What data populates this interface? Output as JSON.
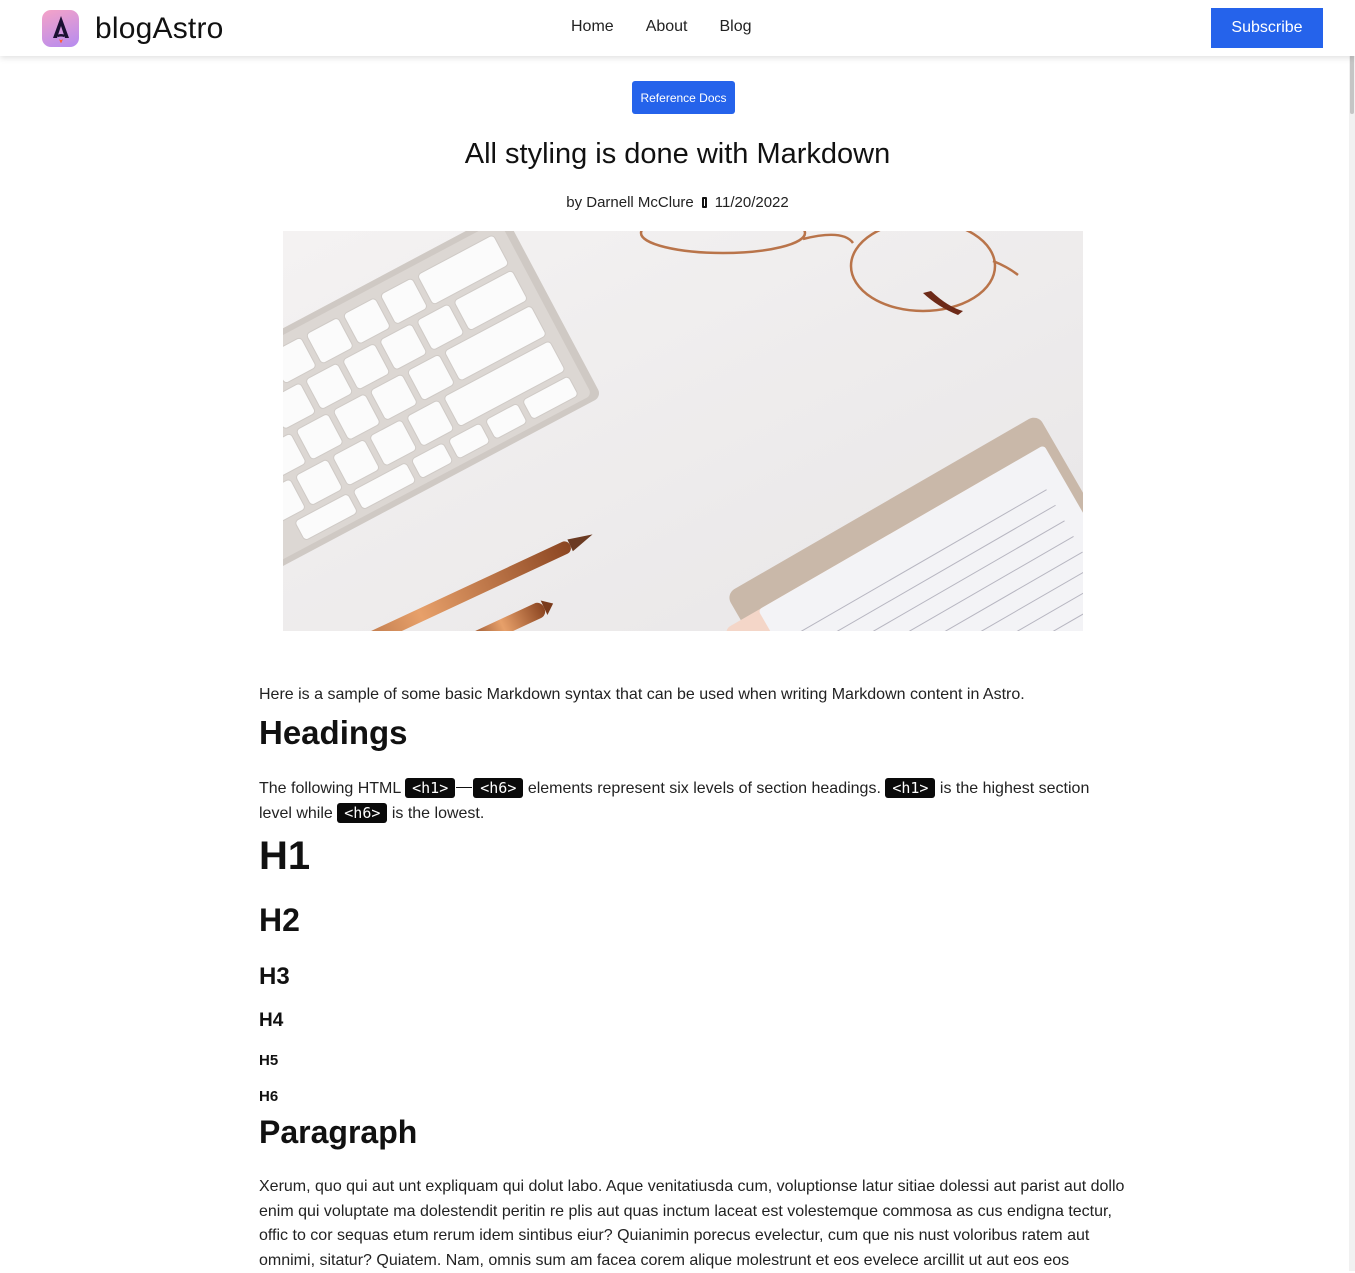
{
  "header": {
    "brand": "blogAstro",
    "nav": [
      "Home",
      "About",
      "Blog"
    ],
    "subscribe_label": "Subscribe"
  },
  "article": {
    "tag": "Reference Docs",
    "title": "All styling is done with Markdown",
    "author": "by Darnell McClure",
    "date": "11/20/2022",
    "intro": "Here is a sample of some basic Markdown syntax that can be used when writing Markdown content in Astro.",
    "headings_title": "Headings",
    "headings_text": {
      "part1": "The following HTML ",
      "code_h1": "<h1>",
      "code_h6": "<h6>",
      "part2": " elements represent six levels of section headings. ",
      "part3": " is the highest section level while ",
      "part4": " is the lowest."
    },
    "h1": "H1",
    "h2": "H2",
    "h3": "H3",
    "h4": "H4",
    "h5": "H5",
    "h6": "H6",
    "paragraph_title": "Paragraph",
    "paragraph_text": "Xerum, quo qui aut unt expliquam qui dolut labo. Aque venitatiusda cum, voluptionse latur sitiae dolessi aut parist aut dollo enim qui voluptate ma dolestendit peritin re plis aut quas inctum laceat est volestemque commosa as cus endigna tectur, offic to cor sequas etum rerum idem sintibus eiur? Quianimin porecus evelectur, cum que nis nust voloribus ratem aut omnimi, sitatur? Quiatem. Nam, omnis sum am facea corem alique molestrunt et eos evelece arcillit ut aut eos eos"
  },
  "colors": {
    "accent": "#2563eb",
    "code_bg": "#0a0a0a",
    "text": "#111111"
  },
  "icons": [
    "astro-logo-icon",
    "separator-icon"
  ]
}
